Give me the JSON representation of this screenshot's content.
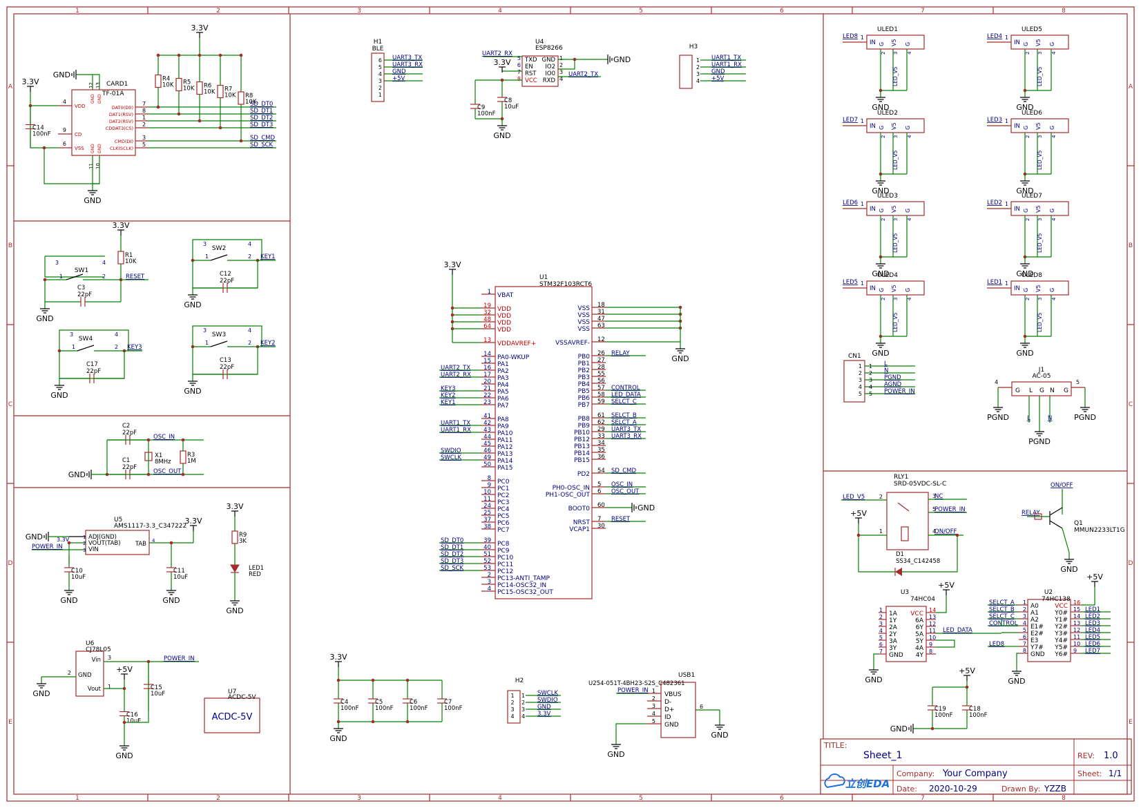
{
  "colors": {
    "frame": "#a52a2a",
    "wire": "#008000",
    "label": "#000080",
    "pin": "#c00000",
    "text": "#000000"
  },
  "border": {
    "cols": [
      "1",
      "2",
      "3",
      "4",
      "5",
      "6",
      "7",
      "8"
    ],
    "rows": [
      "A",
      "B",
      "C",
      "D",
      "E"
    ]
  },
  "title_block": {
    "title_label": "TITLE:",
    "title": "Sheet_1",
    "rev_label": "REV:",
    "rev": "1.0",
    "company_label": "Company:",
    "company": "Your Company",
    "sheet_label": "Sheet:",
    "sheet": "1/1",
    "date_label": "Date:",
    "date": "2020-10-29",
    "drawn_label": "Drawn By:",
    "drawn": "YZZB",
    "logo": "立创EDA"
  },
  "nets": {
    "gnd": "GND",
    "v33": "3.3V",
    "v5": "+5V",
    "pgnd": "PGND"
  },
  "card": {
    "ref": "CARD1",
    "part": "TF-01A",
    "left_pins": [
      [
        "4",
        "VDD"
      ],
      [
        "9",
        "CD"
      ],
      [
        "6",
        "VSS"
      ]
    ],
    "right_pins": [
      [
        "7",
        "DAT0(D0)"
      ],
      [
        "8",
        "DAT1(RSV)"
      ],
      [
        "1",
        "DAT2(RSV)"
      ],
      [
        "2",
        "CDDAT3(CS)"
      ],
      [
        "3",
        "CMD(DI)"
      ],
      [
        "5",
        "CLK(SCLK)"
      ]
    ],
    "top_pins": [
      "12",
      "13"
    ],
    "bottom_pins": [
      "11",
      "10"
    ],
    "gnd_pin": "GND",
    "nets": [
      "SD_DT0",
      "SD_DT1",
      "SD_DT2",
      "SD_DT3",
      "SD_CMD",
      "SD_SCK"
    ],
    "resistors": [
      [
        "R4",
        "10K"
      ],
      [
        "R5",
        "10K"
      ],
      [
        "R6",
        "10K"
      ],
      [
        "R7",
        "10K"
      ],
      [
        "R8",
        "10K"
      ]
    ],
    "cap": [
      "C14",
      "100nF"
    ]
  },
  "reset_block": {
    "sw": "SW1",
    "r": [
      "R1",
      "10K"
    ],
    "c": [
      "C3",
      "22pF"
    ],
    "net": "RESET"
  },
  "keys": [
    {
      "sw": "SW2",
      "c": [
        "C12",
        "22pF"
      ],
      "net": "KEY1"
    },
    {
      "sw": "SW4",
      "c": [
        "C17",
        "22pF"
      ],
      "net": "KEY3"
    },
    {
      "sw": "SW3",
      "c": [
        "C13",
        "22pF"
      ],
      "net": "KEY2"
    }
  ],
  "sw_pins": [
    "1",
    "2",
    "3",
    "4"
  ],
  "osc": {
    "c_a": [
      "C2",
      "22pF"
    ],
    "c_b": [
      "C1",
      "22pF"
    ],
    "x": [
      "X1",
      "8MHz"
    ],
    "r": [
      "R3",
      "1M"
    ],
    "net_in": "OSC_IN",
    "net_out": "OSC_OUT"
  },
  "ldo": {
    "ref": "U5",
    "part": "AMS1117-3.3_C347222",
    "pins": [
      "ADJ(GND)",
      "VOUT(TAB)",
      "VIN"
    ],
    "tab": "TAB",
    "pin_nums": [
      "1",
      "2",
      "3",
      "4"
    ],
    "net_in": "POWER_IN",
    "c10": [
      "C10",
      "10uF"
    ],
    "c11": [
      "C11",
      "10uF"
    ]
  },
  "led_pwr": {
    "r": [
      "R9",
      "3K"
    ],
    "led": [
      "LED1",
      "RED"
    ]
  },
  "u6": {
    "ref": "U6",
    "part": "CJ78L05",
    "pins": [
      "Vin",
      "GND",
      "Vout"
    ],
    "pin_nums": [
      "3",
      "2",
      "1"
    ],
    "net": "POWER_IN",
    "c15": [
      "C15",
      "10uF"
    ],
    "c16": [
      "C16",
      "10uF"
    ]
  },
  "u7": {
    "ref": "U7",
    "part": "ACDC-5V",
    "label": "ACDC-5V"
  },
  "h1": {
    "ref": "H1",
    "part": "BLE",
    "pins": [
      "6",
      "5",
      "4",
      "3",
      "2",
      "1"
    ],
    "nets": [
      "UART3_TX",
      "UART3_RX",
      "GND",
      "+5V"
    ]
  },
  "u4": {
    "ref": "U4",
    "part": "ESP8266",
    "left": [
      [
        "5",
        "TXD"
      ],
      [
        "6",
        "EN"
      ],
      [
        "7",
        "RST"
      ],
      [
        "8",
        "VCC"
      ]
    ],
    "right": [
      [
        "1",
        "GND"
      ],
      [
        "2",
        "IO2"
      ],
      [
        "3",
        "IO0"
      ],
      [
        "4",
        "RXD"
      ]
    ],
    "nets": [
      "UART2_RX",
      "UART2_TX"
    ],
    "c9": [
      "C9",
      "100nF"
    ],
    "c8": [
      "C8",
      "10uF"
    ]
  },
  "h3": {
    "ref": "H3",
    "pins": [
      "1",
      "2",
      "3",
      "4"
    ],
    "nets": [
      "UART1_TX",
      "UART1_RX",
      "GND",
      "+5V"
    ]
  },
  "mcu": {
    "ref": "U1",
    "part": "STM32F103RCT6",
    "left": [
      [
        "1",
        "VBAT"
      ],
      [
        "19",
        "VDD"
      ],
      [
        "32",
        "VDD"
      ],
      [
        "48",
        "VDD"
      ],
      [
        "64",
        "VDD"
      ],
      [
        "13",
        "VDDAVREF+"
      ],
      [
        "14",
        "PA0-WKUP"
      ],
      [
        "15",
        "PA1"
      ],
      [
        "16",
        "PA2"
      ],
      [
        "17",
        "PA3"
      ],
      [
        "20",
        "PA4"
      ],
      [
        "21",
        "PA5"
      ],
      [
        "22",
        "PA6"
      ],
      [
        "23",
        "PA7"
      ],
      [
        "41",
        "PA8"
      ],
      [
        "42",
        "PA9"
      ],
      [
        "43",
        "PA10"
      ],
      [
        "44",
        "PA11"
      ],
      [
        "45",
        "PA12"
      ],
      [
        "46",
        "PA13"
      ],
      [
        "49",
        "PA14"
      ],
      [
        "50",
        "PA15"
      ],
      [
        "8",
        "PC0"
      ],
      [
        "9",
        "PC1"
      ],
      [
        "10",
        "PC2"
      ],
      [
        "11",
        "PC3"
      ],
      [
        "24",
        "PC4"
      ],
      [
        "25",
        "PC5"
      ],
      [
        "37",
        "PC6"
      ],
      [
        "38",
        "PC7"
      ],
      [
        "39",
        "PC8"
      ],
      [
        "40",
        "PC9"
      ],
      [
        "51",
        "PC10"
      ],
      [
        "52",
        "PC11"
      ],
      [
        "53",
        "PC12"
      ],
      [
        "2",
        "PC13-ANTI_TAMP"
      ],
      [
        "3",
        "PC14-OSC32_IN"
      ],
      [
        "4",
        "PC15-OSC32_OUT"
      ]
    ],
    "left_nets": [
      [
        "PA2",
        "UART2_TX"
      ],
      [
        "PA3",
        "UART2_RX"
      ],
      [
        "PA5",
        "KEY3"
      ],
      [
        "PA6",
        "KEY2"
      ],
      [
        "PA7",
        "KEY1"
      ],
      [
        "PA9",
        "UART1_TX"
      ],
      [
        "PA10",
        "UART1_RX"
      ],
      [
        "PA13",
        "SWDIO"
      ],
      [
        "PA14",
        "SWCLK"
      ],
      [
        "PC8",
        "SD_DT0"
      ],
      [
        "PC9",
        "SD_DT1"
      ],
      [
        "PC10",
        "SD_DT2"
      ],
      [
        "PC11",
        "SD_DT3"
      ],
      [
        "PC12",
        "SD_SCK"
      ]
    ],
    "right": [
      [
        "18",
        "VSS"
      ],
      [
        "31",
        "VSS"
      ],
      [
        "47",
        "VSS"
      ],
      [
        "63",
        "VSS"
      ],
      [
        "12",
        "VSSAVREF-"
      ],
      [
        "26",
        "PB0"
      ],
      [
        "27",
        "PB1"
      ],
      [
        "28",
        "PB2"
      ],
      [
        "55",
        "PB3"
      ],
      [
        "56",
        "PB4"
      ],
      [
        "57",
        "PB5"
      ],
      [
        "58",
        "PB6"
      ],
      [
        "59",
        "PB7"
      ],
      [
        "61",
        "PB8"
      ],
      [
        "62",
        "PB9"
      ],
      [
        "29",
        "PB10"
      ],
      [
        "33",
        "PB12"
      ],
      [
        "34",
        "PB13"
      ],
      [
        "35",
        "PB14"
      ],
      [
        "36",
        "PB15"
      ],
      [
        "54",
        "PD2"
      ],
      [
        "5",
        "PH0-OSC_IN"
      ],
      [
        "6",
        "PH1-OSC_OUT"
      ],
      [
        "60",
        "BOOT0"
      ],
      [
        "7",
        "NRST"
      ],
      [
        "30",
        "VCAP1"
      ]
    ],
    "right_nets": [
      [
        "PB0",
        "RELAY"
      ],
      [
        "PB5",
        "CONTROL"
      ],
      [
        "PB6",
        "LED_DATA"
      ],
      [
        "PB7",
        "SELCT_C"
      ],
      [
        "PB8",
        "SELCT_B"
      ],
      [
        "PB9",
        "SELCT_A"
      ],
      [
        "PB10",
        "UART3_TX"
      ],
      [
        "PB12",
        "UART3_RX"
      ],
      [
        "PD2",
        "SD_CMD"
      ],
      [
        "PH0-OSC_IN",
        "OSC_IN"
      ],
      [
        "PH1-OSC_OUT",
        "OSC_OUT"
      ],
      [
        "NRST",
        "RESET"
      ]
    ]
  },
  "decoupling": {
    "caps": [
      [
        "C4",
        "100nF"
      ],
      [
        "C5",
        "100nF"
      ],
      [
        "C6",
        "100nF"
      ],
      [
        "C7",
        "100nF"
      ]
    ]
  },
  "h2": {
    "ref": "H2",
    "pins": [
      "1",
      "2",
      "3",
      "4"
    ],
    "nets": [
      "SWCLK",
      "SWDIO",
      "GND",
      "3.3V"
    ]
  },
  "usb": {
    "ref": "USB1",
    "part": "U254-051T-4BH23-S2S_C482361",
    "pins": [
      [
        "1",
        "VBUS"
      ],
      [
        "2",
        "D-"
      ],
      [
        "3",
        "D+"
      ],
      [
        "4",
        "ID"
      ],
      [
        "5",
        "GND"
      ]
    ],
    "shell": "6",
    "net": "POWER_IN"
  },
  "uleds": [
    {
      "ref": "ULED1",
      "net": "LED8"
    },
    {
      "ref": "ULED5",
      "net": "LED4"
    },
    {
      "ref": "ULED2",
      "net": "LED7"
    },
    {
      "ref": "ULED6",
      "net": "LED3"
    },
    {
      "ref": "ULED3",
      "net": "LED6"
    },
    {
      "ref": "ULED7",
      "net": "LED2"
    },
    {
      "ref": "ULED4",
      "net": "LED5"
    },
    {
      "ref": "ULED8",
      "net": "LED1"
    }
  ],
  "uled_pins": [
    "IN",
    "G",
    "V5",
    "G"
  ],
  "uled_pin_nums": [
    "1",
    "2",
    "3",
    "4"
  ],
  "uled_net": "LED_V5",
  "cn1": {
    "ref": "CN1",
    "pins": [
      "1",
      "2",
      "3",
      "4",
      "5"
    ],
    "nets": [
      "L",
      "N",
      "PGND",
      "AGND",
      "POWER_IN"
    ]
  },
  "j1": {
    "ref": "J1",
    "part": "AC-05",
    "pins": [
      "G",
      "L",
      "G",
      "N",
      "G"
    ],
    "pin_nums": [
      "4",
      "1",
      "2",
      "3",
      "5"
    ],
    "nets": [
      "L",
      "N"
    ]
  },
  "relay": {
    "ref": "RLY1",
    "part": "SRD-05VDC-SL-C",
    "pin_nums": [
      "2",
      "3",
      "5",
      "1",
      "4"
    ],
    "nets": [
      "LED_V5",
      "NC",
      "POWER_IN",
      "ON/OFF"
    ],
    "d1": [
      "D1",
      "SS34_C142458"
    ]
  },
  "q1": {
    "ref": "Q1",
    "part": "MMUN2233LT1G",
    "net_c": "ON/OFF",
    "net_b": "RELAY"
  },
  "u3": {
    "ref": "U3",
    "part": "74HC04",
    "left": [
      [
        "1",
        "1A"
      ],
      [
        "2",
        "1Y"
      ],
      [
        "3",
        "2A"
      ],
      [
        "4",
        "2Y"
      ],
      [
        "5",
        "3A"
      ],
      [
        "6",
        "3Y"
      ],
      [
        "7",
        "GND"
      ]
    ],
    "right": [
      [
        "14",
        "VCC"
      ],
      [
        "13",
        "6A"
      ],
      [
        "12",
        "6Y"
      ],
      [
        "11",
        "5A"
      ],
      [
        "10",
        "5Y"
      ],
      [
        "9",
        "4A"
      ],
      [
        "8",
        "4Y"
      ]
    ],
    "net": "LED_DATA"
  },
  "u2": {
    "ref": "U2",
    "part": "74HC138",
    "left": [
      [
        "1",
        "A0"
      ],
      [
        "2",
        "A1"
      ],
      [
        "3",
        "A2"
      ],
      [
        "4",
        "E1#"
      ],
      [
        "5",
        "E2#"
      ],
      [
        "6",
        "E3"
      ],
      [
        "7",
        "Y7#"
      ],
      [
        "8",
        "GND"
      ]
    ],
    "right": [
      [
        "16",
        "VCC"
      ],
      [
        "15",
        "Y0#"
      ],
      [
        "14",
        "Y1#"
      ],
      [
        "13",
        "Y2#"
      ],
      [
        "12",
        "Y3#"
      ],
      [
        "11",
        "Y4#"
      ],
      [
        "10",
        "Y5#"
      ],
      [
        "9",
        "Y6#"
      ]
    ],
    "left_nets": [
      "SELCT_A",
      "SELCT_B",
      "SELCT_C",
      "CONTROL",
      "",
      "",
      "LED8"
    ],
    "right_nets": [
      "LED1",
      "LED2",
      "LED3",
      "LED4",
      "LED5",
      "LED6",
      "LED7"
    ]
  },
  "caps_5v": [
    [
      "C19",
      "100nF"
    ],
    [
      "C18",
      "100nF"
    ]
  ]
}
